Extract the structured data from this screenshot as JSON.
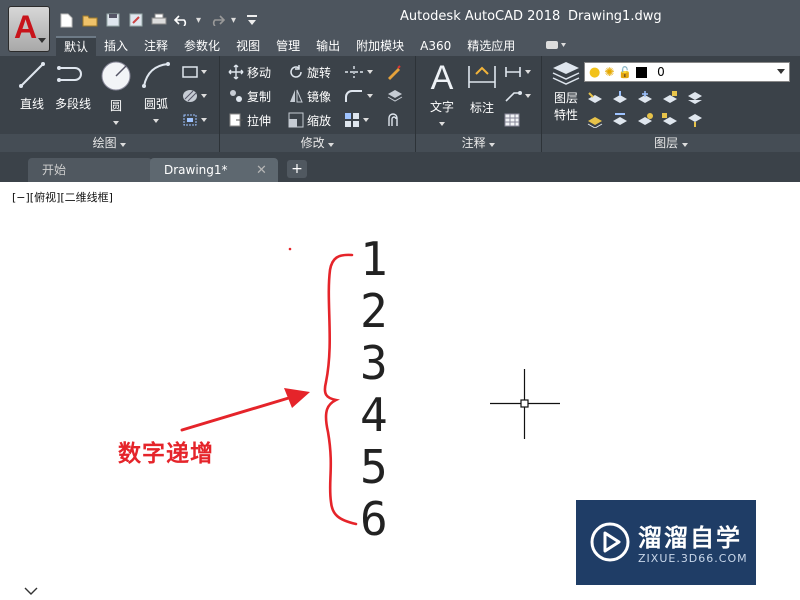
{
  "title_bar": {
    "app_title": "Autodesk AutoCAD 2018",
    "file_name": "Drawing1.dwg"
  },
  "app_button": {
    "letter": "A",
    "accent_color": "#c8141b"
  },
  "ribbon_tabs": [
    "默认",
    "插入",
    "注释",
    "参数化",
    "视图",
    "管理",
    "输出",
    "附加模块",
    "A360",
    "精选应用"
  ],
  "panels": {
    "draw": {
      "title": "绘图",
      "buttons": [
        "直线",
        "多段线",
        "圆",
        "圆弧"
      ]
    },
    "modify": {
      "title": "修改",
      "buttons": [
        "移动",
        "旋转",
        "复制",
        "镜像",
        "拉伸",
        "缩放"
      ]
    },
    "annotation": {
      "title": "注释",
      "buttons": [
        "文字",
        "标注"
      ]
    },
    "layers": {
      "title": "图层",
      "properties_label_1": "图层",
      "properties_label_2": "特性",
      "current_layer": "0"
    }
  },
  "file_tabs": {
    "start": "开始",
    "drawing": "Drawing1*",
    "add": "+"
  },
  "viewport": {
    "label": "[−][俯视][二维线框]"
  },
  "drawing": {
    "numbers": [
      "1",
      "2",
      "3",
      "4",
      "5",
      "6"
    ],
    "annotation": "数字递增",
    "annotation_color": "#e5242a"
  },
  "watermark": {
    "title": "溜溜自学",
    "url": "ZIXUE.3D66.COM"
  },
  "colors": {
    "title_bar": "#4d555e",
    "ribbon": "#3b4249",
    "canvas": "#ffffff"
  }
}
